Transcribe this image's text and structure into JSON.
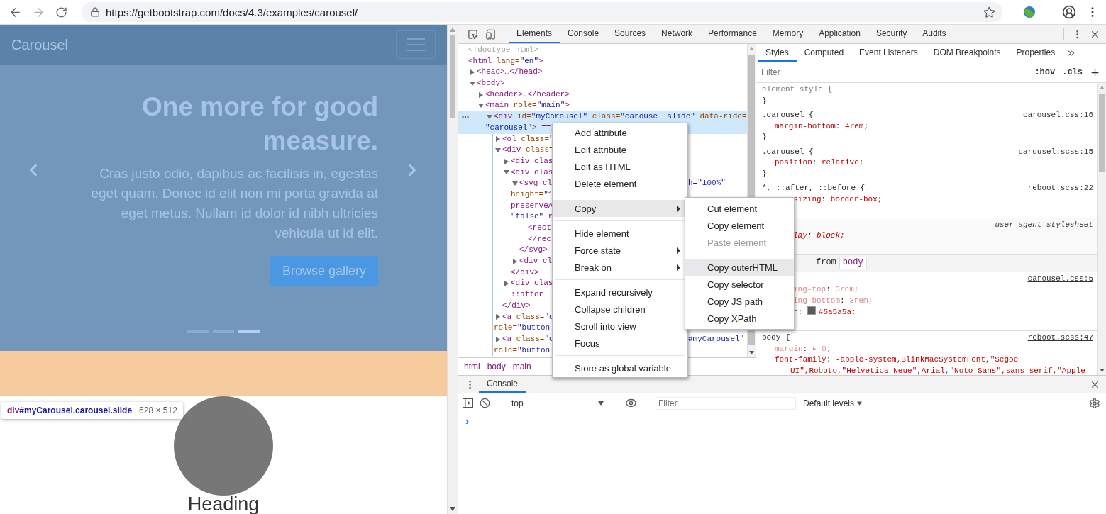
{
  "browser": {
    "url": "https://getbootstrap.com/docs/4.3/examples/carousel/"
  },
  "page": {
    "brand": "Carousel",
    "slide": {
      "heading": "One more for good measure.",
      "text": "Cras justo odio, dapibus ac facilisis in, egestas eget quam. Donec id elit non mi porta gravida at eget metus. Nullam id dolor id nibh ultricies vehicula ut id elit.",
      "button": "Browse gallery"
    },
    "indicators": [
      {
        "selected": false
      },
      {
        "selected": false
      },
      {
        "selected": true
      }
    ],
    "tooltip": {
      "tag": "div",
      "selector": "#myCarousel.carousel.slide",
      "size": "628 × 512"
    },
    "heading": "Heading"
  },
  "devtools": {
    "tabs": [
      {
        "label": "Elements",
        "selected": true
      },
      {
        "label": "Console",
        "selected": false
      },
      {
        "label": "Sources",
        "selected": false
      },
      {
        "label": "Network",
        "selected": false
      },
      {
        "label": "Performance",
        "selected": false
      },
      {
        "label": "Memory",
        "selected": false
      },
      {
        "label": "Application",
        "selected": false
      },
      {
        "label": "Security",
        "selected": false
      },
      {
        "label": "Audits",
        "selected": false
      }
    ],
    "tree": [
      {
        "kind": "doctype",
        "selected": false,
        "lines": [
          "<!doctype html>"
        ]
      },
      {
        "kind": "plain",
        "selected": false,
        "lines": [
          "<html lang=\"en\">"
        ],
        "children": [
          {
            "kind": "node",
            "expanded": false,
            "selected": false,
            "lines": [
              "<head>…</head>"
            ]
          },
          {
            "kind": "node",
            "expanded": true,
            "selected": false,
            "lines": [
              "<body>"
            ],
            "children": [
              {
                "kind": "node",
                "expanded": false,
                "selected": false,
                "lines": [
                  "<header>…</header>"
                ]
              },
              {
                "kind": "node",
                "expanded": true,
                "selected": false,
                "lines": [
                  "<main role=\"main\">"
                ],
                "children": [
                  {
                    "kind": "node",
                    "expanded": true,
                    "selected": true,
                    "lines": [
                      "<div id=\"myCarousel\" class=\"carousel slide\" data-ride=",
                      "\"carousel\"> =="
                    ],
                    "children": [
                      {
                        "kind": "node",
                        "expanded": false,
                        "selected": false,
                        "lines": [
                          "<ol class=\""
                        ]
                      },
                      {
                        "kind": "node",
                        "expanded": true,
                        "selected": false,
                        "lines": [
                          "<div class="
                        ],
                        "children": [
                          {
                            "kind": "node",
                            "expanded": false,
                            "selected": false,
                            "lines": [
                              "<div clas"
                            ]
                          },
                          {
                            "kind": "node",
                            "expanded": true,
                            "selected": false,
                            "lines": [
                              "<div clas"
                            ],
                            "children": [
                              {
                                "kind": "node",
                                "expanded": true,
                                "selected": false,
                                "lines": [
                                  "<svg cl",
                                  "height=\"1",
                                  "preserveA",
                                  "\"false\" r"
                                ],
                                "right": {
                                  "text": "h=\"100%\"",
                                  "link": false
                                },
                                "children": [
                                  {
                                    "kind": "plain",
                                    "selected": false,
                                    "lines": [
                                      "<rect"
                                    ]
                                  },
                                  {
                                    "kind": "plain",
                                    "selected": false,
                                    "lines": [
                                      "</rec"
                                    ]
                                  }
                                ]
                              },
                              {
                                "kind": "plain",
                                "selected": false,
                                "lines": [
                                  "</svg>"
                                ]
                              },
                              {
                                "kind": "node",
                                "expanded": false,
                                "selected": false,
                                "lines": [
                                  "<div cl"
                                ]
                              }
                            ]
                          },
                          {
                            "kind": "plain",
                            "selected": false,
                            "lines": [
                              "</div>"
                            ]
                          },
                          {
                            "kind": "node",
                            "expanded": false,
                            "selected": false,
                            "lines": [
                              "<div clas"
                            ]
                          },
                          {
                            "kind": "plain",
                            "selected": false,
                            "lines": [
                              "::after"
                            ]
                          }
                        ]
                      },
                      {
                        "kind": "plain",
                        "selected": false,
                        "lines": [
                          "</div>"
                        ]
                      },
                      {
                        "kind": "node",
                        "expanded": false,
                        "selected": false,
                        "lines": [
                          "<a class=\"c",
                          "role=\"button"
                        ]
                      },
                      {
                        "kind": "node",
                        "expanded": false,
                        "selected": false,
                        "lines": [
                          "<a class=\"c",
                          "role=\"button"
                        ],
                        "right": {
                          "text": "#myCarousel\"",
                          "link": true
                        }
                      }
                    ]
                  }
                ]
              }
            ]
          }
        ]
      }
    ],
    "breadcrumbs": [
      "html",
      "body",
      "main"
    ],
    "styles_tabs": [
      {
        "label": "Styles",
        "selected": true
      },
      {
        "label": "Computed",
        "selected": false
      },
      {
        "label": "Event Listeners",
        "selected": false
      },
      {
        "label": "DOM Breakpoints",
        "selected": false
      },
      {
        "label": "Properties",
        "selected": false
      }
    ],
    "styles_filter": {
      "placeholder": "Filter",
      "hov": ":hov",
      "cls": ".cls"
    },
    "rules": [
      {
        "kind": "rule",
        "selector": "element.style {",
        "close": "}"
      },
      {
        "kind": "rule",
        "selector": ".carousel {",
        "source": "carousel.css:16",
        "close": "}",
        "props": [
          {
            "kind": "full",
            "text": "margin-bottom: 4rem;",
            "dimmed": false
          }
        ]
      },
      {
        "kind": "rule",
        "selector": ".carousel {",
        "source": "carousel.scss:15",
        "close": "}",
        "props": [
          {
            "kind": "full",
            "text": "position: relative;",
            "dimmed": false
          }
        ]
      },
      {
        "kind": "rule",
        "selector": "*, ::after, ::before {",
        "source": "reboot.scss:22",
        "props": [
          {
            "kind": "cut",
            "text": "sizing: border-box;",
            "dimmed": false
          }
        ]
      },
      {
        "kind": "ua_rule",
        "source": "user agent stylesheet",
        "props": [
          {
            "kind": "cut",
            "text": "lay: block;",
            "dimmed": false
          }
        ]
      },
      {
        "kind": "inherited",
        "label": "from",
        "tag": "body"
      },
      {
        "kind": "rule",
        "source": "carousel.css:5",
        "props": [
          {
            "kind": "cut",
            "text": "ing-top: 3rem;",
            "dimmed": true
          },
          {
            "kind": "cut",
            "text": "ing-bottom: 3rem;",
            "dimmed": true
          },
          {
            "kind": "cut_color",
            "text": "r: #5a5a5a;",
            "dimmed": false
          }
        ]
      },
      {
        "kind": "rule",
        "selector": "body {",
        "source": "reboot.scss:47",
        "props": [
          {
            "kind": "full",
            "text": "margin: ▸ 0;",
            "dimmed": true
          },
          {
            "kind": "full",
            "text": "font-family: -apple-system,BlinkMacSystemFont,\"Segoe UI\",Roboto,\"Helvetica Neue\",Arial,\"Noto Sans\",sans-serif,\"Apple",
            "dimmed": false
          }
        ]
      }
    ],
    "console": {
      "tab": "Console",
      "context": "top",
      "filter_placeholder": "Filter",
      "levels": "Default levels",
      "prompt": "›"
    }
  },
  "context_menu": {
    "groups": [
      [
        {
          "label": "Add attribute",
          "selected": false,
          "submenu": false
        },
        {
          "label": "Edit attribute",
          "selected": false,
          "submenu": false
        },
        {
          "label": "Edit as HTML",
          "selected": false,
          "submenu": false
        },
        {
          "label": "Delete element",
          "selected": false,
          "submenu": false
        }
      ],
      [
        {
          "label": "Copy",
          "selected": true,
          "submenu": true
        }
      ],
      [
        {
          "label": "Hide element",
          "selected": false,
          "submenu": false
        },
        {
          "label": "Force state",
          "selected": false,
          "submenu": true
        },
        {
          "label": "Break on",
          "selected": false,
          "submenu": true
        }
      ],
      [
        {
          "label": "Expand recursively",
          "selected": false,
          "submenu": false
        },
        {
          "label": "Collapse children",
          "selected": false,
          "submenu": false
        },
        {
          "label": "Scroll into view",
          "selected": false,
          "submenu": false
        },
        {
          "label": "Focus",
          "selected": false,
          "submenu": false
        }
      ],
      [
        {
          "label": "Store as global variable",
          "selected": false,
          "submenu": false
        }
      ]
    ]
  },
  "submenu": {
    "groups": [
      [
        {
          "label": "Cut element",
          "selected": false,
          "disabled": false
        },
        {
          "label": "Copy element",
          "selected": false,
          "disabled": false
        },
        {
          "label": "Paste element",
          "selected": false,
          "disabled": true
        }
      ],
      [
        {
          "label": "Copy outerHTML",
          "selected": true,
          "disabled": false
        },
        {
          "label": "Copy selector",
          "selected": false,
          "disabled": false
        },
        {
          "label": "Copy JS path",
          "selected": false,
          "disabled": false
        },
        {
          "label": "Copy XPath",
          "selected": false,
          "disabled": false
        }
      ]
    ]
  }
}
